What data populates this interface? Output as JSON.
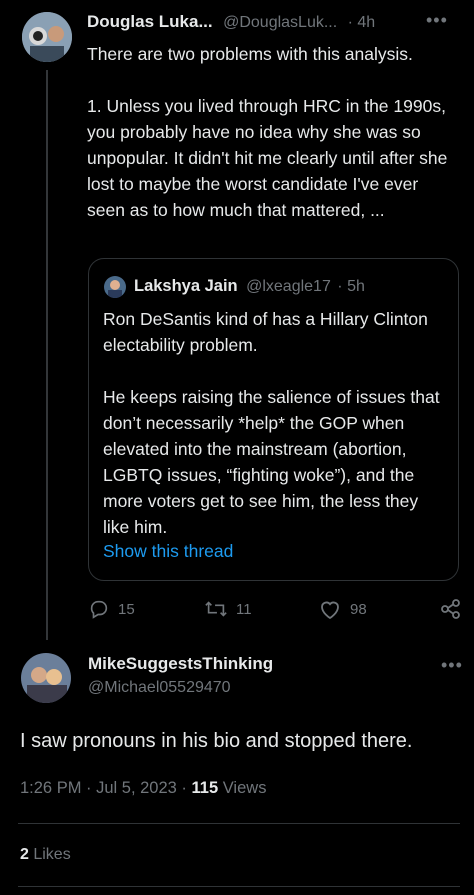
{
  "parent_tweet": {
    "display_name": "Douglas Luka...",
    "handle": "@DouglasLuk...",
    "time": "· 4h",
    "text": "There are two problems with this analysis.\n\n1. Unless you lived through HRC in the 1990s, you probably have no idea why she was so unpopular. It didn't hit me clearly until after she lost to maybe the worst candidate I've ever seen as to how much that mattered, ...",
    "quote": {
      "display_name": "Lakshya Jain",
      "handle": "@lxeagle17",
      "time": "· 5h",
      "text": "Ron DeSantis kind of has a Hillary Clinton electability problem.\n\nHe keeps raising the salience of issues that don’t necessarily *help* the GOP when elevated into the mainstream (abortion, LGBTQ issues, “fighting woke”), and the more voters get to see him, the less they like him.",
      "show_thread": "Show this thread"
    },
    "actions": {
      "replies": "15",
      "retweets": "11",
      "likes": "98"
    }
  },
  "main_tweet": {
    "display_name": "MikeSuggestsThinking",
    "handle": "@Michael05529470",
    "text": "I saw pronouns in his bio and stopped there.",
    "time": "1:26 PM · Jul 5, 2023 · ",
    "views_count": "115",
    "views_label": " Views",
    "likes_count": "2",
    "likes_label": " Likes"
  },
  "icons": {
    "more": "more-dots-icon",
    "reply": "reply-icon",
    "retweet": "retweet-icon",
    "like": "heart-icon",
    "share": "share-icon"
  },
  "colors": {
    "background": "#000000",
    "text": "#e7e9ea",
    "muted": "#71767b",
    "link": "#1d9bf0",
    "border": "#2f3336"
  }
}
